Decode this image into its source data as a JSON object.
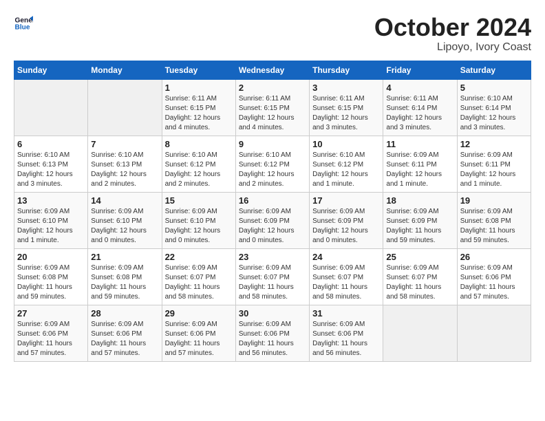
{
  "header": {
    "logo_line1": "General",
    "logo_line2": "Blue",
    "month": "October 2024",
    "location": "Lipoyo, Ivory Coast"
  },
  "weekdays": [
    "Sunday",
    "Monday",
    "Tuesday",
    "Wednesday",
    "Thursday",
    "Friday",
    "Saturday"
  ],
  "weeks": [
    [
      {
        "day": "",
        "info": ""
      },
      {
        "day": "",
        "info": ""
      },
      {
        "day": "1",
        "info": "Sunrise: 6:11 AM\nSunset: 6:15 PM\nDaylight: 12 hours and 4 minutes."
      },
      {
        "day": "2",
        "info": "Sunrise: 6:11 AM\nSunset: 6:15 PM\nDaylight: 12 hours and 4 minutes."
      },
      {
        "day": "3",
        "info": "Sunrise: 6:11 AM\nSunset: 6:15 PM\nDaylight: 12 hours and 3 minutes."
      },
      {
        "day": "4",
        "info": "Sunrise: 6:11 AM\nSunset: 6:14 PM\nDaylight: 12 hours and 3 minutes."
      },
      {
        "day": "5",
        "info": "Sunrise: 6:10 AM\nSunset: 6:14 PM\nDaylight: 12 hours and 3 minutes."
      }
    ],
    [
      {
        "day": "6",
        "info": "Sunrise: 6:10 AM\nSunset: 6:13 PM\nDaylight: 12 hours and 3 minutes."
      },
      {
        "day": "7",
        "info": "Sunrise: 6:10 AM\nSunset: 6:13 PM\nDaylight: 12 hours and 2 minutes."
      },
      {
        "day": "8",
        "info": "Sunrise: 6:10 AM\nSunset: 6:12 PM\nDaylight: 12 hours and 2 minutes."
      },
      {
        "day": "9",
        "info": "Sunrise: 6:10 AM\nSunset: 6:12 PM\nDaylight: 12 hours and 2 minutes."
      },
      {
        "day": "10",
        "info": "Sunrise: 6:10 AM\nSunset: 6:12 PM\nDaylight: 12 hours and 1 minute."
      },
      {
        "day": "11",
        "info": "Sunrise: 6:09 AM\nSunset: 6:11 PM\nDaylight: 12 hours and 1 minute."
      },
      {
        "day": "12",
        "info": "Sunrise: 6:09 AM\nSunset: 6:11 PM\nDaylight: 12 hours and 1 minute."
      }
    ],
    [
      {
        "day": "13",
        "info": "Sunrise: 6:09 AM\nSunset: 6:10 PM\nDaylight: 12 hours and 1 minute."
      },
      {
        "day": "14",
        "info": "Sunrise: 6:09 AM\nSunset: 6:10 PM\nDaylight: 12 hours and 0 minutes."
      },
      {
        "day": "15",
        "info": "Sunrise: 6:09 AM\nSunset: 6:10 PM\nDaylight: 12 hours and 0 minutes."
      },
      {
        "day": "16",
        "info": "Sunrise: 6:09 AM\nSunset: 6:09 PM\nDaylight: 12 hours and 0 minutes."
      },
      {
        "day": "17",
        "info": "Sunrise: 6:09 AM\nSunset: 6:09 PM\nDaylight: 12 hours and 0 minutes."
      },
      {
        "day": "18",
        "info": "Sunrise: 6:09 AM\nSunset: 6:09 PM\nDaylight: 11 hours and 59 minutes."
      },
      {
        "day": "19",
        "info": "Sunrise: 6:09 AM\nSunset: 6:08 PM\nDaylight: 11 hours and 59 minutes."
      }
    ],
    [
      {
        "day": "20",
        "info": "Sunrise: 6:09 AM\nSunset: 6:08 PM\nDaylight: 11 hours and 59 minutes."
      },
      {
        "day": "21",
        "info": "Sunrise: 6:09 AM\nSunset: 6:08 PM\nDaylight: 11 hours and 59 minutes."
      },
      {
        "day": "22",
        "info": "Sunrise: 6:09 AM\nSunset: 6:07 PM\nDaylight: 11 hours and 58 minutes."
      },
      {
        "day": "23",
        "info": "Sunrise: 6:09 AM\nSunset: 6:07 PM\nDaylight: 11 hours and 58 minutes."
      },
      {
        "day": "24",
        "info": "Sunrise: 6:09 AM\nSunset: 6:07 PM\nDaylight: 11 hours and 58 minutes."
      },
      {
        "day": "25",
        "info": "Sunrise: 6:09 AM\nSunset: 6:07 PM\nDaylight: 11 hours and 58 minutes."
      },
      {
        "day": "26",
        "info": "Sunrise: 6:09 AM\nSunset: 6:06 PM\nDaylight: 11 hours and 57 minutes."
      }
    ],
    [
      {
        "day": "27",
        "info": "Sunrise: 6:09 AM\nSunset: 6:06 PM\nDaylight: 11 hours and 57 minutes."
      },
      {
        "day": "28",
        "info": "Sunrise: 6:09 AM\nSunset: 6:06 PM\nDaylight: 11 hours and 57 minutes."
      },
      {
        "day": "29",
        "info": "Sunrise: 6:09 AM\nSunset: 6:06 PM\nDaylight: 11 hours and 57 minutes."
      },
      {
        "day": "30",
        "info": "Sunrise: 6:09 AM\nSunset: 6:06 PM\nDaylight: 11 hours and 56 minutes."
      },
      {
        "day": "31",
        "info": "Sunrise: 6:09 AM\nSunset: 6:06 PM\nDaylight: 11 hours and 56 minutes."
      },
      {
        "day": "",
        "info": ""
      },
      {
        "day": "",
        "info": ""
      }
    ]
  ]
}
